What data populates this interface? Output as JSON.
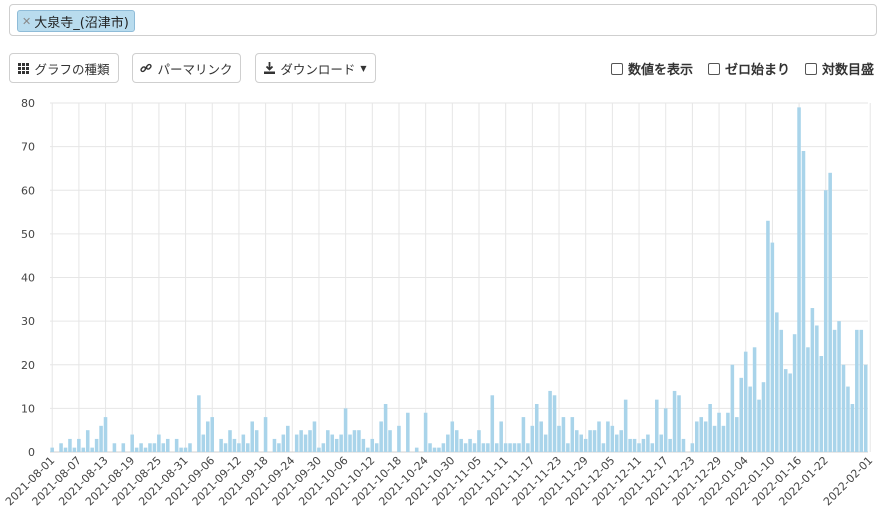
{
  "filter": {
    "tags": [
      {
        "label": "大泉寺_(沼津市)"
      }
    ]
  },
  "toolbar": {
    "chart_type_label": "グラフの種類",
    "permalink_label": "パーマリンク",
    "download_label": "ダウンロード"
  },
  "options": {
    "show_values_label": "数値を表示",
    "zero_start_label": "ゼロ始まり",
    "log_scale_label": "対数目盛"
  },
  "colors": {
    "bar": "#a9d4ea",
    "grid": "#e6e6e6"
  },
  "chart_data": {
    "type": "bar",
    "title": "",
    "xlabel": "",
    "ylabel": "",
    "ylim": [
      0,
      80
    ],
    "yticks": [
      0,
      10,
      20,
      30,
      40,
      50,
      60,
      70,
      80
    ],
    "grid": true,
    "start_date": "2021-08-01",
    "tick_labels": [
      "2021-08-01",
      "2021-08-07",
      "2021-08-13",
      "2021-08-19",
      "2021-08-25",
      "2021-08-31",
      "2021-09-06",
      "2021-09-12",
      "2021-09-18",
      "2021-09-24",
      "2021-09-30",
      "2021-10-06",
      "2021-10-12",
      "2021-10-18",
      "2021-10-24",
      "2021-10-30",
      "2021-11-05",
      "2021-11-11",
      "2021-11-17",
      "2021-11-23",
      "2021-11-29",
      "2021-12-05",
      "2021-12-11",
      "2021-12-17",
      "2021-12-23",
      "2021-12-29",
      "2022-01-04",
      "2022-01-10",
      "2022-01-16",
      "2022-01-22",
      "2022-02-01"
    ],
    "values": [
      1,
      0,
      2,
      1,
      3,
      1,
      3,
      1,
      5,
      1,
      3,
      6,
      8,
      0,
      2,
      0,
      2,
      0,
      4,
      1,
      2,
      1,
      2,
      2,
      4,
      2,
      3,
      0,
      3,
      1,
      1,
      2,
      0,
      13,
      4,
      7,
      8,
      0,
      3,
      2,
      5,
      3,
      2,
      4,
      2,
      7,
      5,
      0,
      8,
      0,
      3,
      2,
      4,
      6,
      0,
      4,
      5,
      4,
      5,
      7,
      1,
      2,
      5,
      4,
      3,
      4,
      10,
      4,
      5,
      5,
      3,
      1,
      3,
      2,
      7,
      11,
      5,
      0,
      6,
      0,
      9,
      0,
      1,
      0,
      9,
      2,
      1,
      1,
      2,
      4,
      7,
      5,
      3,
      2,
      3,
      2,
      5,
      2,
      2,
      13,
      2,
      7,
      2,
      2,
      2,
      2,
      8,
      2,
      6,
      11,
      7,
      4,
      14,
      13,
      6,
      8,
      2,
      8,
      5,
      4,
      3,
      5,
      5,
      7,
      2,
      7,
      6,
      4,
      5,
      12,
      3,
      3,
      2,
      3,
      4,
      2,
      12,
      4,
      10,
      3,
      14,
      13,
      3,
      0,
      2,
      7,
      8,
      7,
      11,
      6,
      9,
      6,
      9,
      20,
      8,
      17,
      23,
      15,
      24,
      12,
      16,
      53,
      48,
      32,
      28,
      19,
      18,
      27,
      79,
      69,
      24,
      33,
      29,
      22,
      60,
      64,
      28,
      30,
      20,
      15,
      11,
      28,
      28,
      20
    ]
  }
}
